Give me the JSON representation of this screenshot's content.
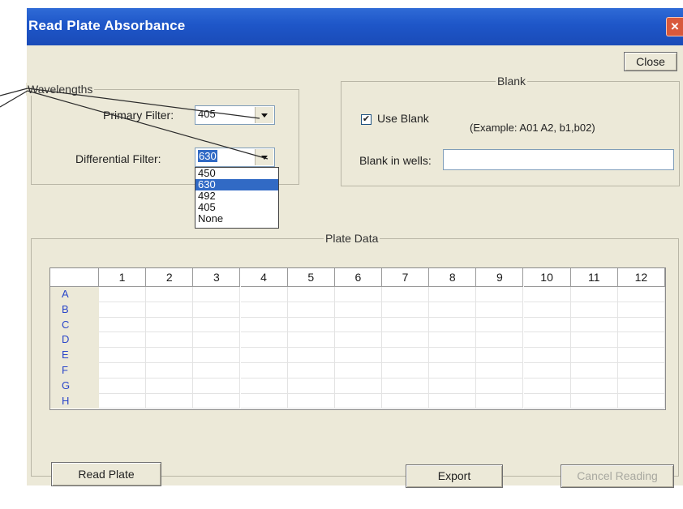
{
  "window": {
    "title": "Read Plate Absorbance",
    "close_x": "×",
    "close_button": "Close"
  },
  "wavelengths": {
    "group_label": "Wavelengths",
    "primary_label": "Primary Filter:",
    "primary_value": "405",
    "differential_label": "Differential Filter:",
    "differential_value": "630",
    "options": [
      "450",
      "630",
      "492",
      "405",
      "None"
    ],
    "highlighted_option": "630"
  },
  "blank": {
    "group_label": "Blank",
    "use_blank_label": "Use Blank",
    "use_blank_checked": true,
    "example_text": "(Example: A01 A2, b1,b02)",
    "wells_label": "Blank in wells:",
    "wells_value": ""
  },
  "plate_data": {
    "group_label": "Plate Data",
    "columns": [
      "1",
      "2",
      "3",
      "4",
      "5",
      "6",
      "7",
      "8",
      "9",
      "10",
      "11",
      "12"
    ],
    "rows": [
      "A",
      "B",
      "C",
      "D",
      "E",
      "F",
      "G",
      "H"
    ]
  },
  "buttons": {
    "read_plate": "Read Plate",
    "export": "Export",
    "cancel_reading": "Cancel Reading"
  },
  "colors": {
    "titlebar": "#1e56c8",
    "selection": "#316ac5",
    "row_header_text": "#2a46c9",
    "dialog_bg": "#ece9d8"
  }
}
